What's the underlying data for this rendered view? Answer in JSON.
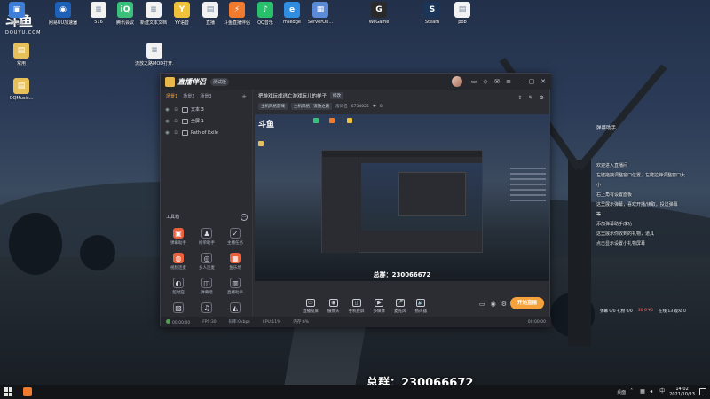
{
  "desktop": {
    "watermark": {
      "logo": "斗鱼",
      "sub": "DOUYU.COM"
    },
    "top_icons": [
      {
        "label": "此电脑",
        "color": "#3d7ed8",
        "glyph": "▣"
      },
      {
        "label": "网易UU加速器",
        "color": "#1e5fb8",
        "glyph": "◉"
      },
      {
        "label": "516",
        "color": "#f2f2f2",
        "glyph": "≡"
      },
      {
        "label": "腾讯会议",
        "color": "#3ac07a",
        "glyph": "iQ"
      },
      {
        "label": "新建文本文档",
        "color": "#f2f2f2",
        "glyph": "≡"
      },
      {
        "label": "YY语音",
        "color": "#f0c13a",
        "glyph": "Y"
      },
      {
        "label": "直播",
        "color": "#f2f2f2",
        "glyph": "▤"
      },
      {
        "label": "斗鱼直播伴侣",
        "color": "#f07b2e",
        "glyph": "⚡"
      },
      {
        "label": "QQ音乐",
        "color": "#28c06a",
        "glyph": "♪"
      },
      {
        "label": "msedge",
        "color": "#2f8ee0",
        "glyph": "e"
      },
      {
        "label": "ServerOn...",
        "color": "#5a8ad8",
        "glyph": "▦"
      },
      {
        "label": "WeGame",
        "color": "#2a2a2a",
        "glyph": "G"
      },
      {
        "label": "Steam",
        "color": "#1b3558",
        "glyph": "S"
      },
      {
        "label": "pob",
        "color": "#f2f2f2",
        "glyph": "▤"
      }
    ],
    "left_icons": [
      {
        "label": "常用",
        "color": "#e8c05a",
        "glyph": "▤"
      },
      {
        "label": "QQMusic...",
        "color": "#e8c05a",
        "glyph": "▤"
      }
    ],
    "mod_icon": {
      "label": "流放之路MOD打开.txt",
      "glyph": "≡"
    },
    "big_group": "总群：230066672"
  },
  "app": {
    "name": "直播伴侣",
    "version": "测试版",
    "titlebar_icons": [
      "message-icon",
      "gift-icon",
      "mail-icon",
      "menu-icon",
      "minimize-icon",
      "maximize-icon",
      "close-icon"
    ],
    "scene_tabs": [
      "场景1",
      "场景2",
      "场景3"
    ],
    "sources": [
      {
        "name": "文本 3"
      },
      {
        "name": "全屏 1"
      },
      {
        "name": "Path of Exile"
      }
    ],
    "toolbox": {
      "title": "工具箱",
      "more": "···"
    },
    "tools": [
      {
        "label": "弹幕助手",
        "glyph": "▣",
        "hot": true
      },
      {
        "label": "榜单助手",
        "glyph": "♟",
        "hot": false
      },
      {
        "label": "主播任务",
        "glyph": "✓",
        "hot": false
      },
      {
        "label": "视频连麦",
        "glyph": "◍",
        "hot": true
      },
      {
        "label": "多人连麦",
        "glyph": "◎",
        "hot": false
      },
      {
        "label": "鱼乐场",
        "glyph": "▦",
        "hot": true
      },
      {
        "label": "超时空",
        "glyph": "◐",
        "hot": false
      },
      {
        "label": "弹幕墙",
        "glyph": "◫",
        "hot": false
      },
      {
        "label": "直播助手",
        "glyph": "▥",
        "hot": false
      },
      {
        "label": "",
        "glyph": "▨",
        "hot": false
      },
      {
        "label": "",
        "glyph": "♫",
        "hot": false
      },
      {
        "label": "",
        "glyph": "◭",
        "hot": false
      }
    ],
    "notice": "斗鱼直播伴侣使用指南",
    "room": {
      "title": "把游戏玩成逃亡游戏玩儿的样子",
      "edit_tag": "修改",
      "category1": "主机风格游戏",
      "category2": "主机风格 · 流放之路",
      "room_label": "房间名",
      "room_id": "6734025",
      "likes": "0"
    },
    "preview": {
      "logo": "斗鱼",
      "group": "总群：230066672"
    },
    "controls": [
      {
        "label": "直播投屏",
        "glyph": "▭"
      },
      {
        "label": "摄像头",
        "glyph": "◉"
      },
      {
        "label": "手机投屏",
        "glyph": "▯"
      },
      {
        "label": "多媒体",
        "glyph": "▶"
      },
      {
        "label": "麦克风",
        "glyph": "🎤"
      },
      {
        "label": "扬声器",
        "glyph": "🔈"
      }
    ],
    "go_live": "开始直播",
    "status": {
      "duration": "00:00:00",
      "fps": "FPS:30",
      "bitrate": "码率:0kbps",
      "cpu": "CPU:11%",
      "memory": "内存:6%",
      "time": "00:00:00"
    }
  },
  "overlay": {
    "title": "弹幕助手",
    "lines": [
      "欢迎进入直播间",
      "左键拖拽调整窗口位置，左键拉伸调整窗口大",
      "小",
      "右上角有设置面板",
      "这里展示弹幕，喜欢开播/读取，投送弹幕",
      "等",
      "添加弹幕助手成功",
      "这里展示你收到的礼物，道具",
      "点击显示设置小礼物屏幕"
    ],
    "stats": {
      "a": "弹幕 0/0 礼物 0/0",
      "b": "30 6 ¥0",
      "c": "在线 13 观众 0"
    }
  },
  "taskbar": {
    "tray_text": "桌面",
    "time": "14:02",
    "date": "2021/10/13"
  }
}
